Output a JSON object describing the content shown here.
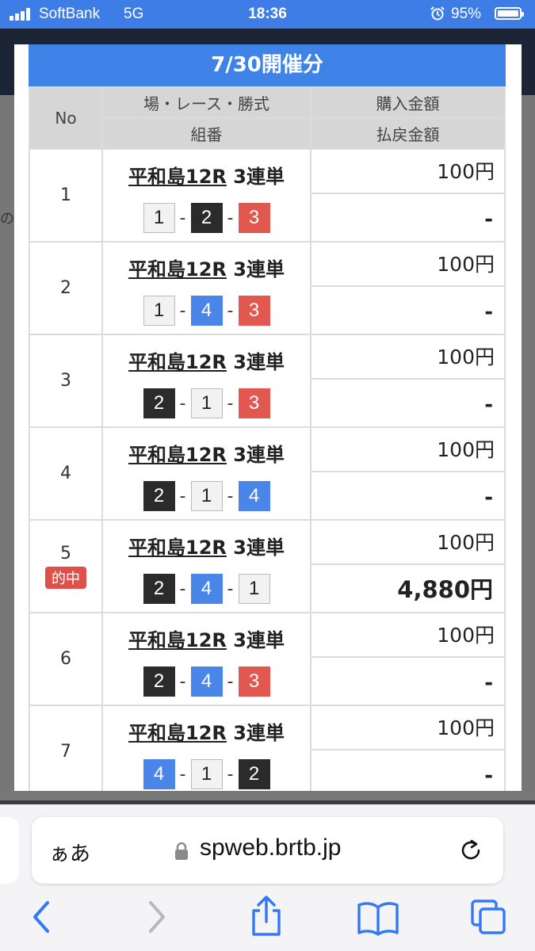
{
  "status_bar": {
    "carrier": "SoftBank",
    "network": "5G",
    "time": "18:36",
    "battery": "95%",
    "battery_level": 0.95
  },
  "background": {
    "hint_text": "の",
    "bottom_hint": "一"
  },
  "modal": {
    "title": "7/30開催分",
    "headers": {
      "no": "No",
      "race_top": "場・レース・勝式",
      "race_bottom": "組番",
      "amount_top": "購入金額",
      "amount_bottom": "払戻金額"
    },
    "rows": [
      {
        "no": "1",
        "venue": "平和島12R",
        "bet_type": "3連単",
        "combo": [
          "1",
          "2",
          "3"
        ],
        "purchase": "100円",
        "payout": "-",
        "hit": ""
      },
      {
        "no": "2",
        "venue": "平和島12R",
        "bet_type": "3連単",
        "combo": [
          "1",
          "4",
          "3"
        ],
        "purchase": "100円",
        "payout": "-",
        "hit": ""
      },
      {
        "no": "3",
        "venue": "平和島12R",
        "bet_type": "3連単",
        "combo": [
          "2",
          "1",
          "3"
        ],
        "purchase": "100円",
        "payout": "-",
        "hit": ""
      },
      {
        "no": "4",
        "venue": "平和島12R",
        "bet_type": "3連単",
        "combo": [
          "2",
          "1",
          "4"
        ],
        "purchase": "100円",
        "payout": "-",
        "hit": ""
      },
      {
        "no": "5",
        "venue": "平和島12R",
        "bet_type": "3連単",
        "combo": [
          "2",
          "4",
          "1"
        ],
        "purchase": "100円",
        "payout": "4,880円",
        "hit": "的中"
      },
      {
        "no": "6",
        "venue": "平和島12R",
        "bet_type": "3連単",
        "combo": [
          "2",
          "4",
          "3"
        ],
        "purchase": "100円",
        "payout": "-",
        "hit": ""
      },
      {
        "no": "7",
        "venue": "平和島12R",
        "bet_type": "3連単",
        "combo": [
          "4",
          "1",
          "2"
        ],
        "purchase": "100円",
        "payout": "-",
        "hit": ""
      }
    ]
  },
  "browser": {
    "aa_label": "ぁあ",
    "url": "spweb.brtb.jp",
    "icons": [
      "back-icon",
      "forward-icon",
      "share-icon",
      "bookmarks-icon",
      "tabs-icon"
    ]
  },
  "colors": {
    "boat_1": "#f2f2f2",
    "boat_2": "#2b2b2b",
    "boat_3": "#e0584f",
    "boat_4": "#4a86e8",
    "title_bar": "#3f82e8",
    "hit_badge": "#e0504a"
  }
}
